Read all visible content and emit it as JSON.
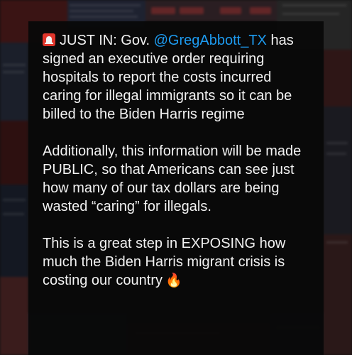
{
  "post": {
    "alert_icon": "rotating-light-icon",
    "line1_prefix": "JUST IN: Gov. ",
    "mention": "@GregAbbott_TX",
    "line1_suffix": " has signed an executive order requiring hospitals to report the costs incurred caring for illegal immigrants so it can be billed to the Biden Harris regime",
    "paragraph2": "Additionally, this information will be made PUBLIC, so that Americans can see just how many of our tax dollars are being wasted “caring” for illegals.",
    "paragraph3": "This is a great step in EXPOSING how much the Biden Harris migrant crisis is costing our country",
    "end_icon": "fire-icon",
    "end_glyph": "🔥"
  },
  "colors": {
    "text": "#f2f2f2",
    "mention": "#1d9bf0",
    "background": "#080808",
    "siren": "#e0352b"
  }
}
